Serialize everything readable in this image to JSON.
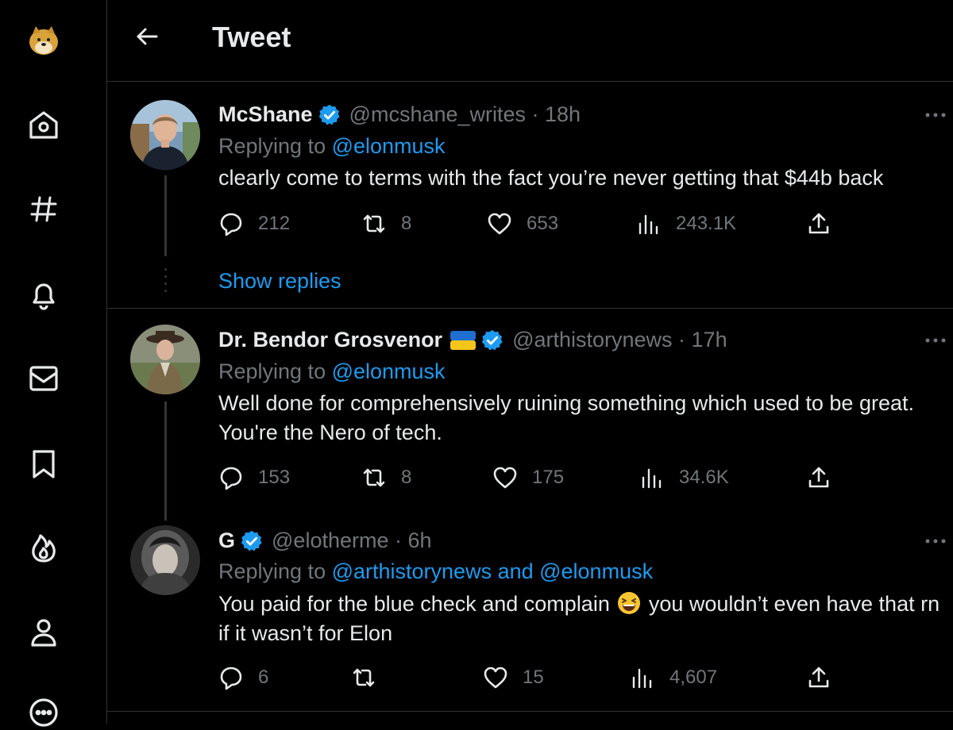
{
  "header": {
    "title": "Tweet"
  },
  "sidebar": {
    "items": [
      {
        "icon": "doge-logo-icon"
      },
      {
        "icon": "home-icon"
      },
      {
        "icon": "hashtag-icon"
      },
      {
        "icon": "bell-icon"
      },
      {
        "icon": "mail-icon"
      },
      {
        "icon": "bookmark-icon"
      },
      {
        "icon": "flame-icon"
      },
      {
        "icon": "profile-icon"
      },
      {
        "icon": "more-circle-icon"
      }
    ]
  },
  "tweets": [
    {
      "name": "McShane",
      "handle": "@mcshane_writes · 18h",
      "replying_prefix": "Replying to ",
      "replying_to": "@elonmusk",
      "text": "clearly come to terms with the fact you’re never getting that $44b back",
      "replies": "212",
      "retweets": "8",
      "likes": "653",
      "views": "243.1K",
      "show_replies": "Show replies"
    },
    {
      "name": "Dr. Bendor Grosvenor",
      "handle": "@arthistorynews · 17h",
      "replying_prefix": "Replying to ",
      "replying_to": "@elonmusk",
      "text_line1": "Well done for comprehensively ruining something which used to be great.",
      "text_line2": "You're the Nero of tech.",
      "replies": "153",
      "retweets": "8",
      "likes": "175",
      "views": "34.6K"
    },
    {
      "name": "G",
      "handle": "@elotherme · 6h",
      "replying_prefix": "Replying to ",
      "replying_to": "@arthistorynews and @elonmusk",
      "text_part1": "You paid for the blue check and complain",
      "text_part2": " you wouldn’t even have that rn if it wasn’t for Elon",
      "replies": "6",
      "retweets": "",
      "likes": "15",
      "views": "4,607"
    }
  ],
  "colors": {
    "accent": "#1d9bf0",
    "muted": "#71767b",
    "text": "#e7e9ea",
    "border": "#2f3336",
    "background": "#000000"
  }
}
